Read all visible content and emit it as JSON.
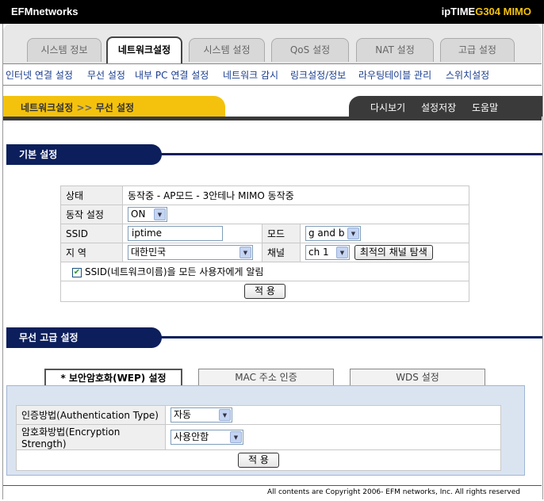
{
  "header": {
    "brand": "EFMnetworks",
    "model_prefix": "ipTIME",
    "model_name": "G304 MIMO"
  },
  "tabs": [
    "시스템 정보",
    "네트워크설정",
    "시스템 설정",
    "QoS 설정",
    "NAT 설정",
    "고급 설정"
  ],
  "subnav": [
    "인터넷 연결 설정",
    "무선 설정",
    "내부 PC 연결 설정",
    "네트워크 감시",
    "링크설정/정보",
    "라우팅테이블 관리",
    "스위치설정"
  ],
  "breadcrumb": {
    "section": "네트워크설정",
    "separator": ">>",
    "page": "무선 설정"
  },
  "actions": [
    "다시보기",
    "설정저장",
    "도움말"
  ],
  "basic": {
    "title": "기본 설정",
    "status_label": "상태",
    "status_value": "동작중 - AP모드 - 3안테나 MIMO 동작중",
    "op_label": "동작 설정",
    "op_value": "ON",
    "ssid_label": "SSID",
    "ssid_value": "iptime",
    "mode_label": "모드",
    "mode_value": "g and b",
    "region_label": "지 역",
    "region_value": "대한민국",
    "channel_label": "채널",
    "channel_value": "ch 1",
    "channel_search": "최적의 채널 탐색",
    "broadcast_label": "SSID(네트워크이름)을 모든 사용자에게 알림",
    "broadcast_checked": true,
    "apply": "적 용"
  },
  "advanced": {
    "title": "무선 고급 설정",
    "tabs": [
      "* 보안암호화(WEP) 설정",
      "MAC 주소 인증",
      "WDS 설정"
    ],
    "auth_label": "인증방법(Authentication Type)",
    "auth_value": "자동",
    "enc_label": "암호화방법(Encryption Strength)",
    "enc_value": "사용안함",
    "apply": "적 용"
  },
  "footer": {
    "copyright": "All contents are Copyright   2006- EFM networks, Inc. All rights reserved"
  },
  "colors": {
    "navy": "#0c1f5c",
    "yellow": "#f4c20d",
    "link": "#1a3d8f",
    "dark": "#3a3a3a"
  },
  "icons": {
    "dropdown": "chevron-down-icon",
    "check": "checkmark-icon"
  }
}
